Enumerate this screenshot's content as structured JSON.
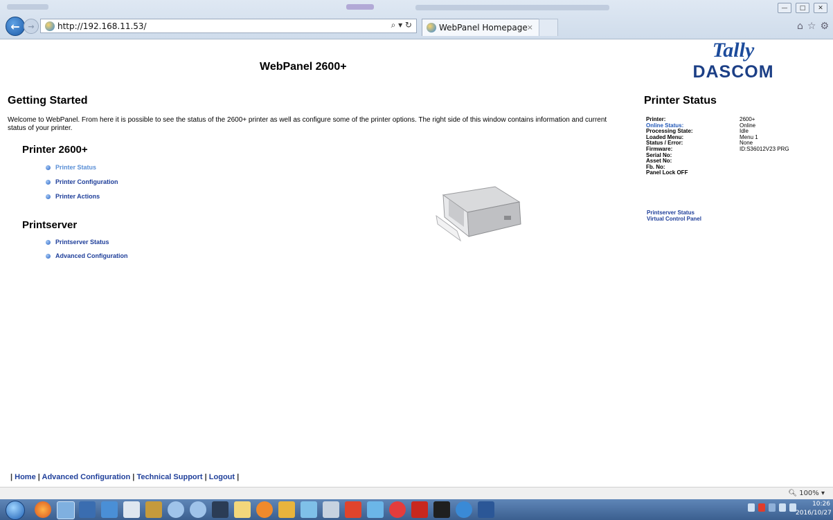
{
  "browser": {
    "url": "http://192.168.11.53/",
    "tab_title": "WebPanel Homepage",
    "tab_close": "×",
    "window_buttons": [
      "—",
      "□",
      "✕"
    ],
    "zoom": "100%"
  },
  "page": {
    "header_title": "WebPanel 2600+",
    "logo": {
      "top": "Tally",
      "bottom": "DASCOM"
    },
    "getting_started": {
      "title": "Getting Started",
      "text": "Welcome to WebPanel. From here it is possible to see the status of the 2600+ printer as well as configure some of the printer options. The right side of this window contains information and current status of your printer."
    },
    "printer_section": {
      "title": "Printer 2600+",
      "links": [
        "Printer Status",
        "Printer Configuration",
        "Printer Actions"
      ]
    },
    "printserver_section": {
      "title": "Printserver",
      "links": [
        "Printserver Status",
        "Advanced Configuration"
      ]
    },
    "printer_status": {
      "title": "Printer Status",
      "rows": [
        {
          "label": "Printer:",
          "value": "2600+"
        },
        {
          "label": "Online Status:",
          "value": "Online"
        },
        {
          "label": "Processing State:",
          "value": "Idle"
        },
        {
          "label": "Loaded Menu:",
          "value": "Menu 1"
        },
        {
          "label": "Status / Error:",
          "value": "None"
        },
        {
          "label": "Firmware:",
          "value": "ID:S36012V23 PRG"
        },
        {
          "label": "Serial No:",
          "value": ""
        },
        {
          "label": "Asset No:",
          "value": ""
        },
        {
          "label": "Fb. No:",
          "value": ""
        },
        {
          "label": "Panel Lock OFF",
          "value": ""
        }
      ],
      "links": [
        "Printserver Status",
        "Virtual Control Panel"
      ]
    },
    "footer_links": [
      "Home",
      "Advanced Configuration",
      "Technical Support",
      "Logout"
    ]
  },
  "taskbar": {
    "time": "10:26",
    "date": "2016/10/27"
  }
}
